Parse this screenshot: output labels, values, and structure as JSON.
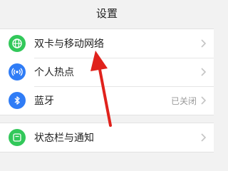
{
  "header": {
    "title": "设置"
  },
  "colors": {
    "accent_green": "#32c85a",
    "accent_blue": "#2f7cf6",
    "arrow_red": "#e0221c"
  },
  "groups": [
    {
      "items": [
        {
          "label": "双卡与移动网络",
          "icon": "globe-icon",
          "value": ""
        },
        {
          "label": "个人热点",
          "icon": "hotspot-icon",
          "value": ""
        },
        {
          "label": "蓝牙",
          "icon": "bluetooth-icon",
          "value": "已关闭"
        }
      ]
    },
    {
      "items": [
        {
          "label": "状态栏与通知",
          "icon": "notification-icon",
          "value": ""
        }
      ]
    }
  ]
}
